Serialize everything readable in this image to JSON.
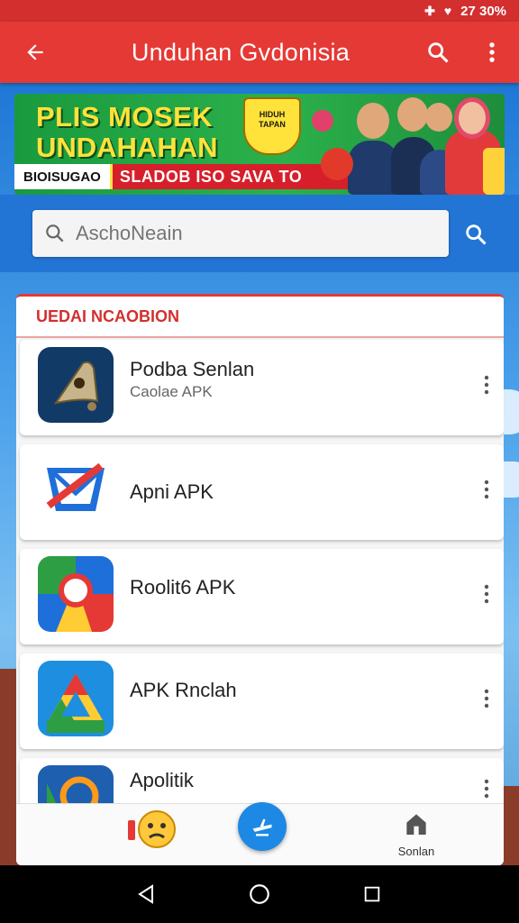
{
  "status_bar": {
    "text": "27 30%"
  },
  "app_bar": {
    "title": "Unduhan Gvdonisia"
  },
  "banner": {
    "line1": "PLIS MOSEK",
    "line2": "UNDAHAHAN",
    "badge": "HIDUH TAPAN",
    "strip_left": "BIOISUGAO",
    "strip_mid": "SLADOB ISO SAVA TO"
  },
  "search": {
    "placeholder": "AschoNeain"
  },
  "section": {
    "title": "UEDAI NCAOBION"
  },
  "apps": [
    {
      "name": "Podba Senlan",
      "sub": "Caolae APK"
    },
    {
      "name": "Apni APK",
      "sub": ""
    },
    {
      "name": "Roolit6 APK",
      "sub": ""
    },
    {
      "name": "APK Rnclah",
      "sub": ""
    },
    {
      "name": "Apolitik",
      "sub": ""
    }
  ],
  "bottom_nav": {
    "home_label": "Sonlan"
  },
  "colors": {
    "primary": "#e53935",
    "accent": "#1e88e5",
    "banner": "#2bb14b"
  }
}
